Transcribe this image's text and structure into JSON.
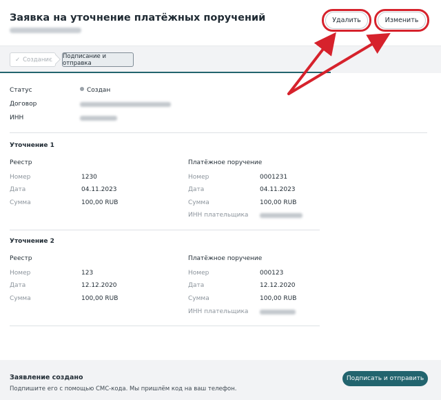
{
  "header": {
    "title": "Заявка на уточнение платёжных поручений",
    "delete_label": "Удалить",
    "edit_label": "Изменить"
  },
  "steps": {
    "done_label": "Создание",
    "active_label": "Подписание и отправка"
  },
  "summary": {
    "status_label": "Статус",
    "status_value": "Создан",
    "contract_label": "Договор",
    "inn_label": "ИНН"
  },
  "clarifications": [
    {
      "title": "Уточнение 1",
      "registry": {
        "heading": "Реестр",
        "number_label": "Номер",
        "number": "1230",
        "date_label": "Дата",
        "date": "04.11.2023",
        "amount_label": "Сумма",
        "amount": "100,00 RUB"
      },
      "payment_order": {
        "heading": "Платёжное поручение",
        "number_label": "Номер",
        "number": "0001231",
        "date_label": "Дата",
        "date": "04.11.2023",
        "amount_label": "Сумма",
        "amount": "100,00 RUB",
        "payer_inn_label": "ИНН плательщика"
      }
    },
    {
      "title": "Уточнение 2",
      "registry": {
        "heading": "Реестр",
        "number_label": "Номер",
        "number": "123",
        "date_label": "Дата",
        "date": "12.12.2020",
        "amount_label": "Сумма",
        "amount": "100,00 RUB"
      },
      "payment_order": {
        "heading": "Платёжное поручение",
        "number_label": "Номер",
        "number": "000123",
        "date_label": "Дата",
        "date": "12.12.2020",
        "amount_label": "Сумма",
        "amount": "100,00 RUB",
        "payer_inn_label": "ИНН плательщика"
      }
    }
  ],
  "footer": {
    "title": "Заявление создано",
    "text": "Подпишите его с помощью СМС-кода. Мы пришлём код на ваш телефон.",
    "submit_label": "Подписать и отправить"
  },
  "colors": {
    "accent": "#22646e",
    "highlight": "#d6222c"
  }
}
